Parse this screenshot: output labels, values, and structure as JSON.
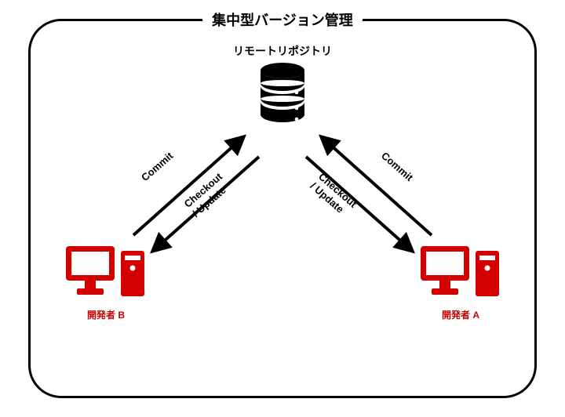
{
  "title": "集中型バージョン管理",
  "remote_repo_label": "リモートリポジトリ",
  "developers": {
    "a": {
      "label": "開発者 A"
    },
    "b": {
      "label": "開発者 B"
    }
  },
  "arrows": {
    "commit_label": "Commit",
    "checkout_label": "Checkout\n/ Update"
  },
  "colors": {
    "dev_accent": "#d40000",
    "frame": "#000000"
  }
}
